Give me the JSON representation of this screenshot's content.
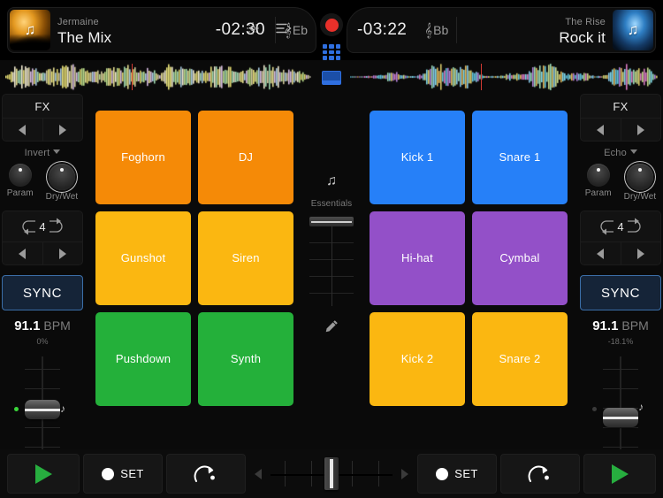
{
  "decks": {
    "left": {
      "artist": "Jermaine",
      "track": "The Mix",
      "timecode": "-02:30",
      "key": "Eb",
      "fx": {
        "title": "FX",
        "selected": "Invert",
        "param_label": "Param",
        "drywet_label": "Dry/Wet",
        "loop_value": "4"
      },
      "sync_label": "SYNC",
      "bpm": "91.1",
      "bpm_label": "BPM",
      "pitch_pct": "0%",
      "minus_label": "−",
      "plus_label": "+"
    },
    "right": {
      "artist": "The Rise",
      "track": "Rock it",
      "timecode": "-03:22",
      "key": "Bb",
      "fx": {
        "title": "FX",
        "selected": "Echo",
        "param_label": "Param",
        "drywet_label": "Dry/Wet",
        "loop_value": "4"
      },
      "sync_label": "SYNC",
      "bpm": "91.1",
      "bpm_label": "BPM",
      "pitch_pct": "-18.1%",
      "minus_label": "−",
      "plus_label": "+"
    }
  },
  "header": {
    "icons": [
      "gear-icon",
      "queue-icon",
      "record-icon",
      "loop-target-icon",
      "split-view-icon",
      "list-view-icon",
      "display-icon",
      "keypad-icon",
      "airplay-icon"
    ],
    "clef_glyph": "𝄞"
  },
  "pads": {
    "left": [
      {
        "label": "Foghorn",
        "color": "#F58A07"
      },
      {
        "label": "DJ",
        "color": "#F58A07"
      },
      {
        "label": "Gunshot",
        "color": "#FBB711"
      },
      {
        "label": "Siren",
        "color": "#FBB711"
      },
      {
        "label": "Pushdown",
        "color": "#24B03A"
      },
      {
        "label": "Synth",
        "color": "#24B03A"
      }
    ],
    "right": [
      {
        "label": "Kick 1",
        "color": "#2680F8"
      },
      {
        "label": "Snare 1",
        "color": "#2680F8"
      },
      {
        "label": "Hi-hat",
        "color": "#9350C8"
      },
      {
        "label": "Cymbal",
        "color": "#9350C8"
      },
      {
        "label": "Kick 2",
        "color": "#FBB711"
      },
      {
        "label": "Snare 2",
        "color": "#FBB711"
      }
    ]
  },
  "center": {
    "essentials_label": "Essentials",
    "music_note_glyph": "♫",
    "pencil_glyph": "✎"
  },
  "transport": {
    "left": {
      "play": "play-icon",
      "set_label": "SET",
      "loop_label": "repeat-icon"
    },
    "right": {
      "play": "play-icon",
      "set_label": "SET",
      "loop_label": "repeat-icon"
    }
  },
  "colors": {
    "accent_blue": "#2F6FE0",
    "record_red": "#E8302A",
    "play_green": "#27AE3F",
    "sync_border": "#3B6EA8",
    "playhead": "#D23A32"
  }
}
